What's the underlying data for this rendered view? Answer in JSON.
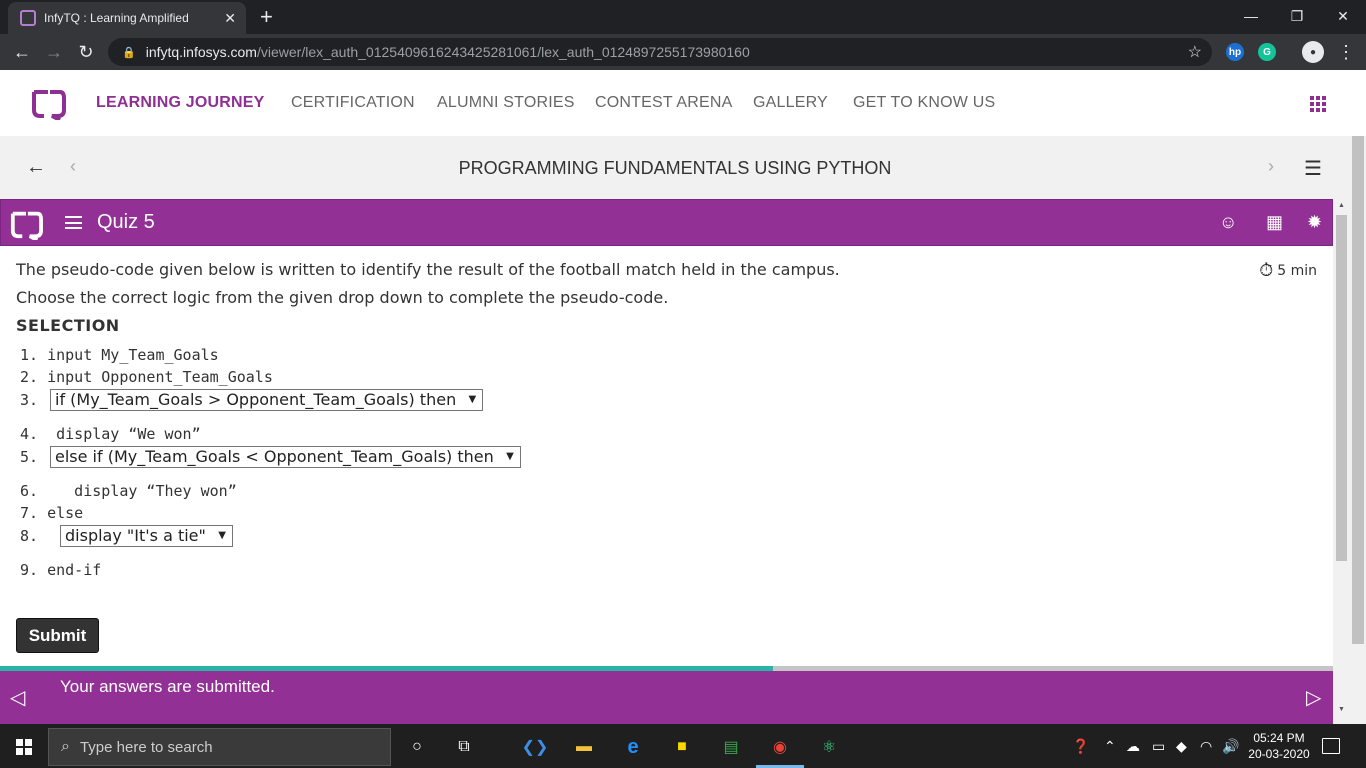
{
  "browser": {
    "tab_title": "InfyTQ : Learning Amplified",
    "url_host": "infytq.infosys.com",
    "url_path": "/viewer/lex_auth_012540961624342528106​1/lex_auth_0124897255173980160"
  },
  "site_nav": {
    "items": [
      {
        "label": "LEARNING JOURNEY",
        "active": true
      },
      {
        "label": "CERTIFICATION",
        "active": false
      },
      {
        "label": "ALUMNI STORIES",
        "active": false
      },
      {
        "label": "CONTEST ARENA",
        "active": false
      },
      {
        "label": "GALLERY",
        "active": false
      },
      {
        "label": "GET TO KNOW US",
        "active": false
      }
    ]
  },
  "course": {
    "title": "PROGRAMMING FUNDAMENTALS USING PYTHON"
  },
  "quiz": {
    "title": "Quiz 5",
    "timer": "5 min",
    "question_line1": "The pseudo-code given below is written to identify the result of the football match held in the campus.",
    "question_line2": "Choose the correct logic from the given drop down to complete the pseudo-code.",
    "type_label": "SELECTION",
    "code": {
      "l1": "1. input My_Team_Goals",
      "l2": "2. input Opponent_Team_Goals",
      "l3_num": "3.",
      "l4": "4.  display “We won”",
      "l5_num": "5.",
      "l6": "6.    display “They won”",
      "l7": "7. else",
      "l8_num": "8.",
      "l9": "9. end-if"
    },
    "dropdowns": {
      "d1": "if (My_Team_Goals > Opponent_Team_Goals) then",
      "d2": "else if (My_Team_Goals < Opponent_Team_Goals) then",
      "d3": "display \"It's a tie\""
    },
    "submit_label": "Submit",
    "progress": 0.58
  },
  "footer": {
    "message": "Your answers are submitted."
  },
  "taskbar": {
    "search_placeholder": "Type here to search",
    "time": "05:24 PM",
    "date": "20-03-2020"
  },
  "colors": {
    "brand_purple": "#933096",
    "progress_teal": "#2ab3a6"
  }
}
